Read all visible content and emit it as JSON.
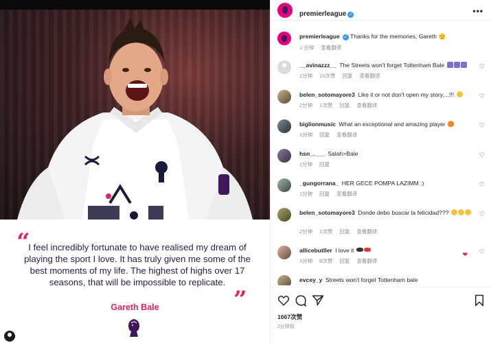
{
  "post": {
    "account": "premierleague",
    "verified_mark": "✓",
    "more_label": "•••",
    "caption_text": "Thanks for the memories, Gareth 🫡",
    "caption_meta": {
      "time": "1 分钟",
      "translate": "查看翻译"
    },
    "likes": "1667次赞",
    "timestamp": "2分钟前"
  },
  "image": {
    "quote_text": "I feel incredibly fortunate to have realised my dream of playing the sport I love. It has truly given me some of the best moments of my life. The highest of highs over 17 seasons, that will be impossible to replicate.",
    "quote_author": "Gareth Bale",
    "open_quote": "“",
    "close_quote": "”"
  },
  "comments": [
    {
      "user": "__avinazzz__",
      "text": "The Streets won't forget Tottenham Bale",
      "emoji": [
        "tottenham",
        "tottenham",
        "tottenham"
      ],
      "meta": [
        "1分钟",
        "10次赞",
        "回复",
        "查看翻译"
      ],
      "avatar": "default"
    },
    {
      "user": "belen_sotomayore3",
      "text": "Like it or not don't open my story....!!!",
      "emoji": [
        "grin"
      ],
      "meta": [
        "2分钟",
        "1次赞",
        "回复",
        "查看翻译"
      ],
      "avatar": "photo"
    },
    {
      "user": "biglionmusic",
      "text": "What an exceptional and amazing player",
      "emoji": [
        "fire"
      ],
      "meta": [
        "1分钟",
        "回复",
        "查看翻译"
      ],
      "avatar": "photo"
    },
    {
      "user": "hsn_.___",
      "text": "Salah>Bale",
      "emoji": [],
      "meta": [
        "1分钟",
        "回复"
      ],
      "avatar": "photo"
    },
    {
      "user": "_gungorrana_",
      "text": "HER GECE POMPA LAZIMM :)",
      "emoji": [],
      "meta": [
        "1分钟",
        "回复",
        "查看翻译"
      ],
      "avatar": "photo"
    },
    {
      "user": "belen_sotomayore3",
      "text": "Donde debo buscar la felicidad???",
      "emoji": [
        "cry",
        "cry",
        "cry"
      ],
      "meta": [
        "2分钟",
        "1次赞",
        "回复",
        "查看翻译"
      ],
      "avatar": "photo"
    },
    {
      "user": "allicebutller",
      "text": "I love it",
      "emoji": [
        "heart",
        "sunglasses",
        "lips"
      ],
      "meta": [
        "1分钟",
        "9次赞",
        "回复",
        "查看翻译"
      ],
      "avatar": "photo"
    },
    {
      "user": "evcey_y",
      "text": "Streets won't forget Tottenham bale",
      "emoji": [],
      "meta": [],
      "avatar": "photo"
    }
  ],
  "icons": {
    "like": "heart-outline-icon",
    "comment": "comment-bubble-icon",
    "share": "paper-plane-icon",
    "save": "bookmark-icon"
  },
  "colors": {
    "accent": "#e0245e",
    "brand_purple": "#3d195b",
    "pl_pink": "#e6007e",
    "verified": "#3897f0"
  }
}
